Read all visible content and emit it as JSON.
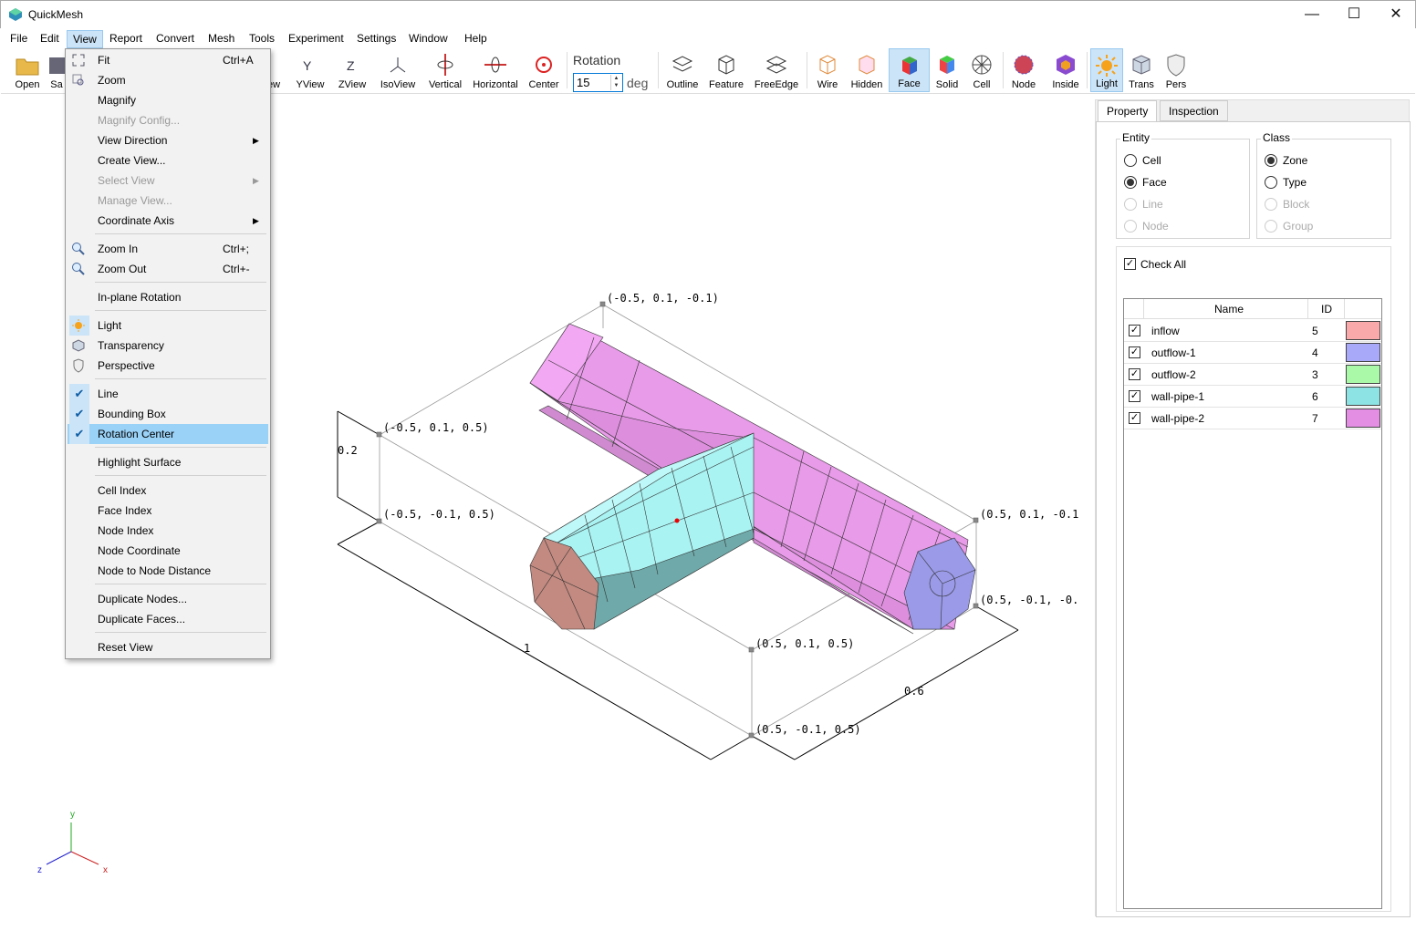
{
  "window": {
    "title": "QuickMesh",
    "minimize": "—",
    "maximize": "☐",
    "close": "✕"
  },
  "menubar": [
    "File",
    "Edit",
    "View",
    "Report",
    "Convert",
    "Mesh",
    "Tools",
    "Experiment",
    "Settings",
    "Window",
    "Help"
  ],
  "toolbar": {
    "open": "Open",
    "save": "Sa",
    "xview": "ew",
    "yview": "YView",
    "zview": "ZView",
    "isoview": "IsoView",
    "vertical": "Vertical",
    "horizontal": "Horizontal",
    "center": "Center",
    "rotation_label": "Rotation",
    "rotation_value": "15",
    "rotation_unit": "deg",
    "outline": "Outline",
    "feature": "Feature",
    "freeedge": "FreeEdge",
    "wire": "Wire",
    "hidden": "Hidden",
    "face": "Face",
    "solid": "Solid",
    "cell": "Cell",
    "node": "Node",
    "inside": "Inside",
    "light": "Light",
    "trans": "Trans",
    "pers": "Pers"
  },
  "view_menu": {
    "fit": "Fit",
    "fit_shortcut": "Ctrl+A",
    "zoom": "Zoom",
    "magnify": "Magnify",
    "magnify_config": "Magnify Config...",
    "view_direction": "View Direction",
    "create_view": "Create View...",
    "select_view": "Select View",
    "manage_view": "Manage View...",
    "coordinate_axis": "Coordinate Axis",
    "zoom_in": "Zoom In",
    "zoom_in_shortcut": "Ctrl+;",
    "zoom_out": "Zoom Out",
    "zoom_out_shortcut": "Ctrl+-",
    "inplane_rotation": "In-plane Rotation",
    "light": "Light",
    "transparency": "Transparency",
    "perspective": "Perspective",
    "line": "Line",
    "bounding_box": "Bounding Box",
    "rotation_center": "Rotation Center",
    "highlight_surface": "Highlight Surface",
    "cell_index": "Cell Index",
    "face_index": "Face Index",
    "node_index": "Node Index",
    "node_coordinate": "Node Coordinate",
    "node_distance": "Node to Node Distance",
    "duplicate_nodes": "Duplicate Nodes...",
    "duplicate_faces": "Duplicate Faces...",
    "reset_view": "Reset View"
  },
  "viewport": {
    "labels": {
      "top_back": "(-0.5, 0.1, -0.1)",
      "left_top": "(-0.5, 0.1, 0.5)",
      "left_bottom": "(-0.5, -0.1, 0.5)",
      "right_top": "(0.5, 0.1, -0.1",
      "right_bottom": "(0.5, -0.1, -0.",
      "front_top": "(0.5, 0.1, 0.5)",
      "front_bottom": "(0.5, -0.1, 0.5)",
      "dim_height": "0.2",
      "dim_length": "1",
      "dim_width": "0.6"
    },
    "axis": {
      "x": "x",
      "y": "y",
      "z": "z"
    }
  },
  "panel": {
    "tabs": [
      "Property",
      "Inspection"
    ],
    "entity_title": "Entity",
    "entity": [
      "Cell",
      "Face",
      "Line",
      "Node"
    ],
    "class_title": "Class",
    "class": [
      "Zone",
      "Type",
      "Block",
      "Group"
    ],
    "check_all": "Check All",
    "col_name": "Name",
    "col_id": "ID",
    "rows": [
      {
        "name": "inflow",
        "id": "5",
        "color": "#f9a9a9"
      },
      {
        "name": "outflow-1",
        "id": "4",
        "color": "#a9a9f9"
      },
      {
        "name": "outflow-2",
        "id": "3",
        "color": "#a9f9a9"
      },
      {
        "name": "wall-pipe-1",
        "id": "6",
        "color": "#8de3e3"
      },
      {
        "name": "wall-pipe-2",
        "id": "7",
        "color": "#e38de3"
      }
    ]
  }
}
